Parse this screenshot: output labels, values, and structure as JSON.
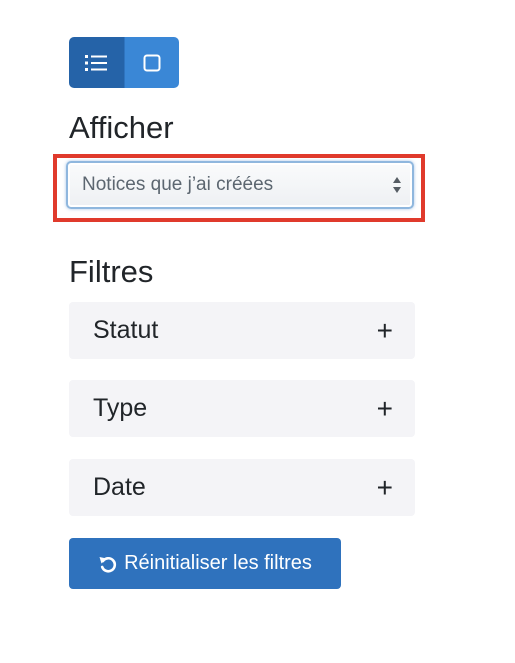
{
  "view_toggle": {
    "list_icon": "list-icon",
    "grid_icon": "square-icon",
    "active": "list"
  },
  "afficher": {
    "title": "Afficher",
    "selected": "Notices que j’ai créées"
  },
  "filtres": {
    "title": "Filtres",
    "items": [
      {
        "label": "Statut",
        "icon": "plus-icon",
        "symbol": "+"
      },
      {
        "label": "Type",
        "icon": "plus-icon",
        "symbol": "+"
      },
      {
        "label": "Date",
        "icon": "plus-icon",
        "symbol": "+"
      }
    ]
  },
  "reset": {
    "label": "Réinitialiser les filtres",
    "icon": "undo-icon"
  },
  "colors": {
    "primary": "#2f72bd",
    "primary_dark": "#2563a8",
    "highlight": "#e03a2c",
    "filter_bg": "#f4f4f7"
  }
}
